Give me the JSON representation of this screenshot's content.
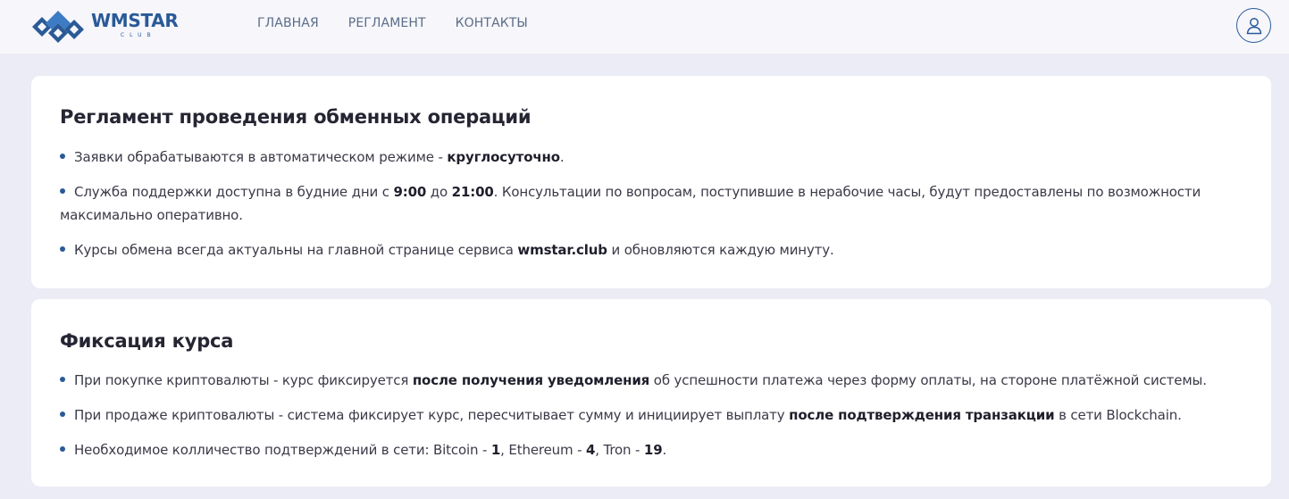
{
  "header": {
    "logo_name": "WMSTAR",
    "logo_sub": "CLUB",
    "nav": [
      "ГЛАВНАЯ",
      "РЕГЛАМЕНТ",
      "КОНТАКТЫ"
    ],
    "user_icon": "user-icon",
    "brand_color": "#2a5a97"
  },
  "sections": [
    {
      "title": "Регламент проведения обменных операций",
      "items": [
        {
          "parts": [
            "Заявки обрабатываются в автоматическом режиме - ",
            "круглосуточно",
            "."
          ]
        },
        {
          "parts": [
            "Служба поддержки доступна в будние дни с ",
            "9:00",
            " до ",
            "21:00",
            ". Консультации по вопросам, поступившие в нерабочие часы, будут предоставлены по возможности максимально оперативно."
          ]
        },
        {
          "parts": [
            "Курсы обмена всегда актуальны на главной странице сервиса ",
            "wmstar.club",
            " и обновляются каждую минуту."
          ]
        }
      ]
    },
    {
      "title": "Фиксация курса",
      "items": [
        {
          "parts": [
            "При покупке криптовалюты - курс фиксируется ",
            "после получения уведомления",
            " об успешности платежа через форму оплаты, на стороне платёжной системы."
          ]
        },
        {
          "parts": [
            "При продаже криптовалюты - система фиксирует курс, пересчитывает сумму и инициирует выплату ",
            "после подтверждения транзакции",
            " в сети Blockchain."
          ]
        },
        {
          "parts": [
            "Необходимое колличество подтверждений в сети: Bitcoin - ",
            "1",
            ", Ethereum - ",
            "4",
            ", Tron - ",
            "19",
            "."
          ]
        }
      ]
    }
  ]
}
